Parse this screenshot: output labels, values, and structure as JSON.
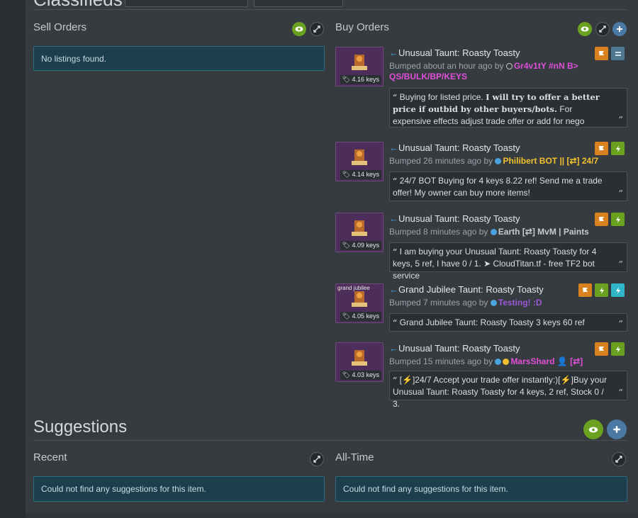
{
  "header": {
    "title": "Classifieds"
  },
  "sell_orders": {
    "label": "Sell Orders",
    "empty_message": "No listings found."
  },
  "buy_orders": {
    "label": "Buy Orders",
    "listings": [
      {
        "item": "Unusual Taunt: Roasty Toasty",
        "price": "4.16 keys",
        "effect": "",
        "bumped": "Bumped about an hour ago by",
        "user": "Gr4v1tY #nN B> QS/BULK/BP/KEYS",
        "user_color": "#e04fd8",
        "message_parts": [
          "Buying for listed price.",
          "I will try to offer a better price if outbid by other buyers/bots.",
          "For expensive effects adjust trade offer or add for nego"
        ]
      },
      {
        "item": "Unusual Taunt: Roasty Toasty",
        "price": "4.14 keys",
        "effect": "",
        "bumped": "Bumped 26 minutes ago by",
        "user": "Philibert BOT || [⇄] 24/7",
        "user_color": "#f2c12e",
        "message": "24/7 BOT Buying for 4 keys 8.22 ref! Send me a trade offer! My owner can buy more items!"
      },
      {
        "item": "Unusual Taunt: Roasty Toasty",
        "price": "4.09 keys",
        "effect": "",
        "bumped": "Bumped 8 minutes ago by",
        "user": "Earth [⇄] MvM | Paints",
        "user_color": "#c9c9c9",
        "message": "I am buying your Unusual Taunt: Roasty Toasty for 4 keys, 5 ref, I have 0 / 1. ➤ CloudTitan.tf - free TF2 bot service"
      },
      {
        "item": "Grand Jubilee Taunt: Roasty Toasty",
        "price": "4.05 keys",
        "effect": "grand jubilee",
        "bumped": "Bumped 7 minutes ago by",
        "user": "Testing! :D",
        "user_color": "#9b59d6",
        "message": "Grand Jubilee Taunt: Roasty Toasty 3 keys 60 ref"
      },
      {
        "item": "Unusual Taunt: Roasty Toasty",
        "price": "4.03 keys",
        "effect": "",
        "bumped": "Bumped 15 minutes ago by",
        "user": "MarsShard",
        "user_suffix": "[⇄]",
        "user_color": "#e04fd8",
        "message": "[⚡]24/7 Accept your trade offer instantly:)[⚡]Buy your Unusual Taunt: Roasty Toasty for 4 keys, 2 ref, Stock 0 / 3."
      }
    ]
  },
  "suggestions": {
    "title": "Suggestions",
    "recent_label": "Recent",
    "alltime_label": "All-Time",
    "recent_message": "Could not find any suggestions for this item.",
    "alltime_message": "Could not find any suggestions for this item."
  },
  "colors": {
    "accent_blue": "#4aa3df",
    "info_bg": "#1c3e4d",
    "green": "#6aa121",
    "orange": "#d9801f"
  }
}
